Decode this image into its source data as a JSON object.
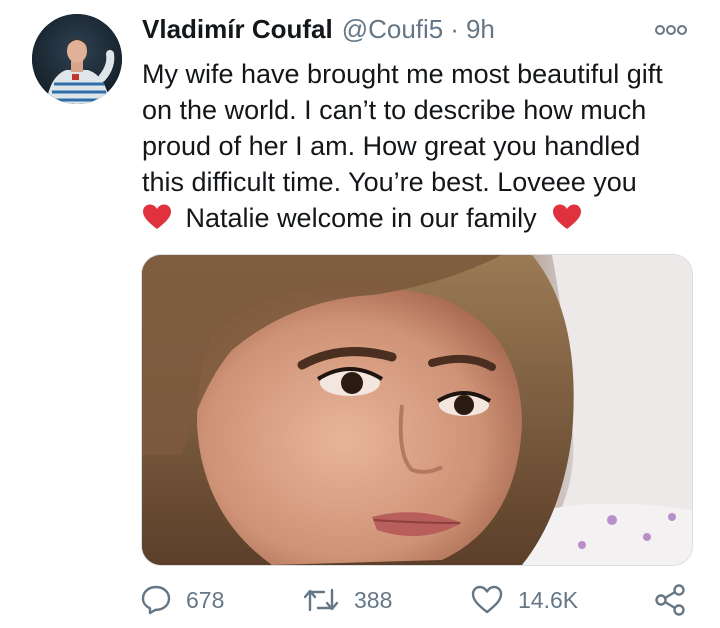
{
  "tweet": {
    "author_name": "Vladimír Coufal",
    "handle": "@Coufi5",
    "separator": "·",
    "time": "9h",
    "text_lines": [
      "My wife have brought me most beautiful gift",
      "on the world. I can’t to describe how much",
      "proud of her I am. How great you handled",
      "this difficult time. You’re best. Loveee you"
    ],
    "last_line_text": "Natalie welcome in our family",
    "emoji": "red-heart",
    "photo_description_icon": "photo-selfie",
    "counts": {
      "replies": "678",
      "retweets": "388",
      "likes": "14.6K"
    }
  },
  "colors": {
    "text_primary": "#14171a",
    "text_secondary": "#657786",
    "heart_red": "#e0313f"
  }
}
